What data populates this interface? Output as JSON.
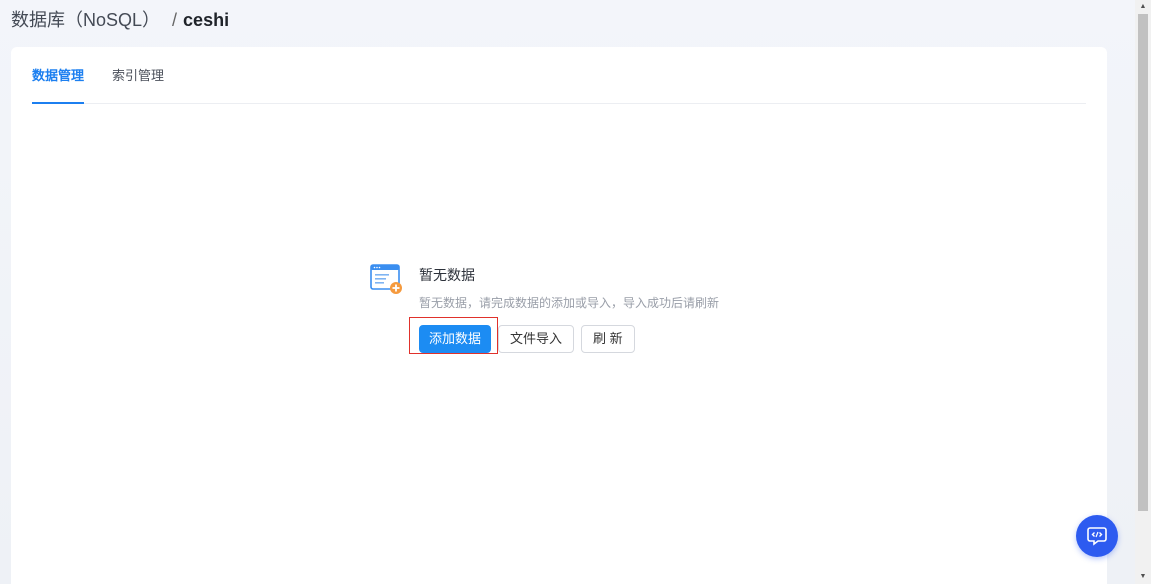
{
  "breadcrumb": {
    "parent": "数据库（NoSQL）",
    "separator": "/",
    "current": "ceshi"
  },
  "tabs": [
    {
      "label": "数据管理",
      "active": true
    },
    {
      "label": "索引管理",
      "active": false
    }
  ],
  "empty_state": {
    "icon": "empty-data-icon",
    "title": "暂无数据",
    "description": "暂无数据，请完成数据的添加或导入，导入成功后请刷新"
  },
  "actions": {
    "add_label": "添加数据",
    "import_label": "文件导入",
    "refresh_label": "刷 新"
  },
  "colors": {
    "accent": "#1c7ff0",
    "primary_button": "#1c8cf3",
    "highlight": "#e0312b",
    "fab": "#2d5bf0"
  },
  "fab": {
    "icon": "code-chat-icon"
  }
}
